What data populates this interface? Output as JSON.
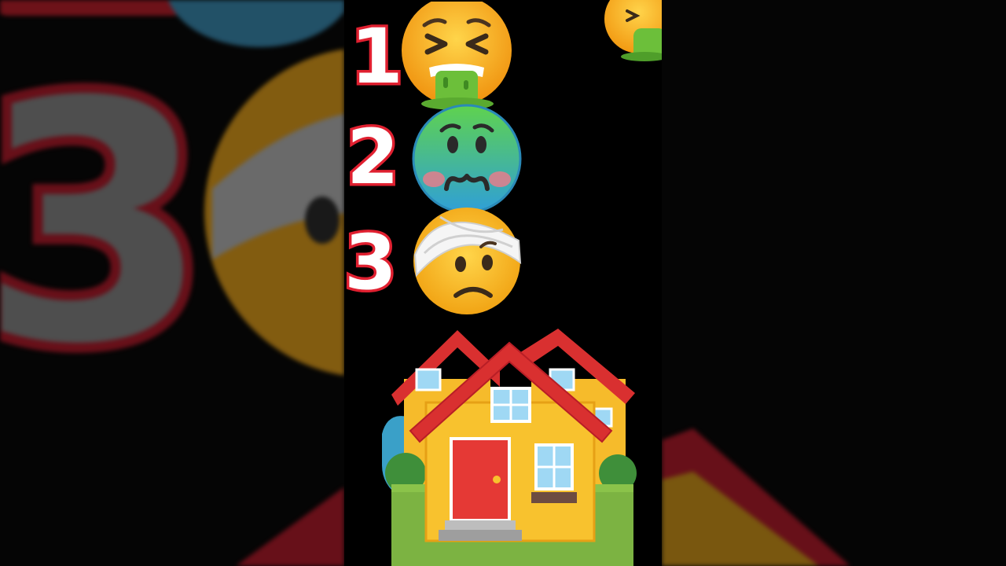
{
  "video": {
    "ranking": [
      {
        "rank": "1",
        "emoji": "face-vomiting"
      },
      {
        "rank": "2",
        "emoji": "nauseated-face"
      },
      {
        "rank": "3",
        "emoji": "face-with-head-bandage"
      }
    ],
    "featured_emoji": "houses",
    "background_number": "3"
  },
  "colors": {
    "background": "#000000",
    "rank_stroke": "#e02030",
    "rank_fill": "#ffffff",
    "face_yellow": "#f7b718",
    "vomit_green": "#6cbf3a",
    "nauseated_green": "#4fc36a",
    "nauseated_blue": "#3aa8d8",
    "roof_red": "#d93030",
    "house_yellow": "#f6bb2b",
    "grass_green": "#7cb342"
  }
}
